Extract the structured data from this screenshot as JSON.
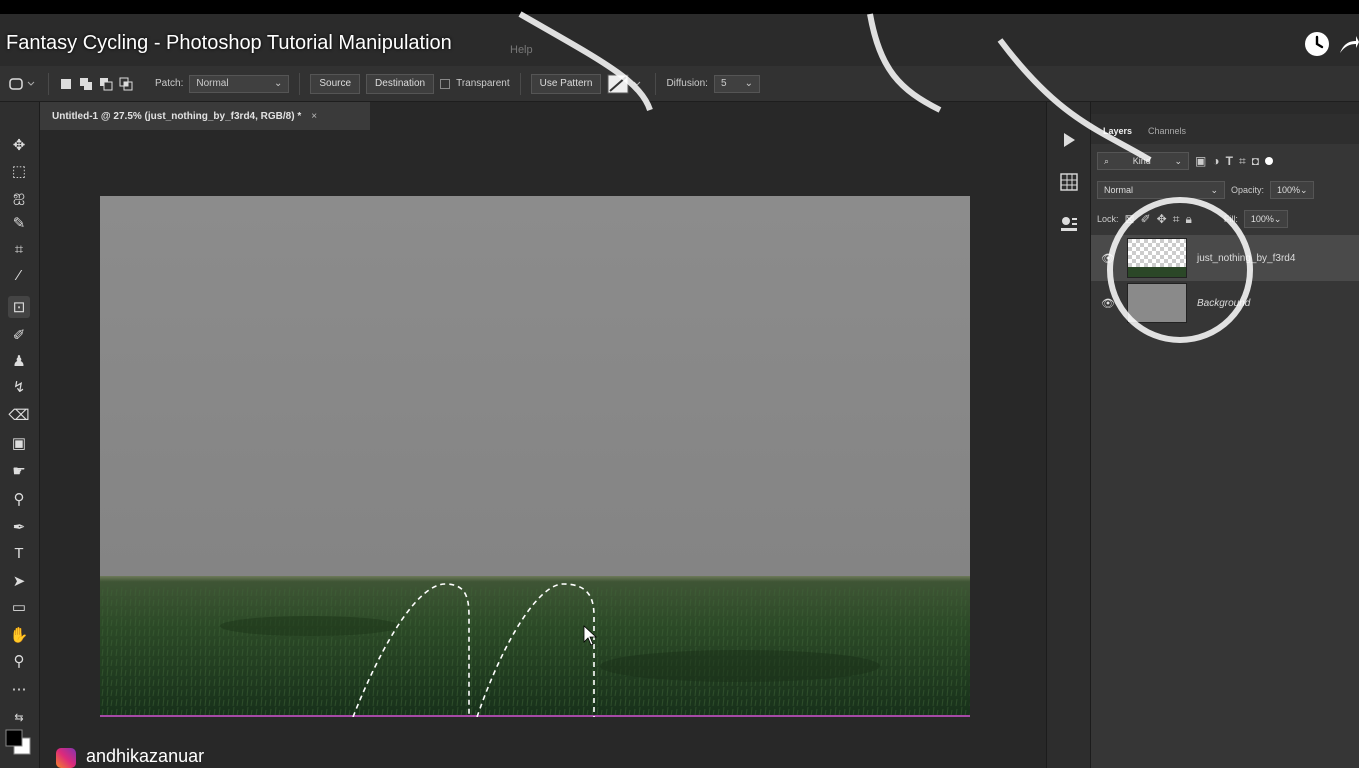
{
  "video": {
    "title": "Fantasy Cycling - Photoshop Tutorial Manipulation",
    "menu_ghost": "Help"
  },
  "options_bar": {
    "patch_label": "Patch:",
    "patch_value": "Normal",
    "source_label": "Source",
    "destination_label": "Destination",
    "transparent_label": "Transparent",
    "use_pattern_label": "Use Pattern",
    "diffusion_label": "Diffusion:",
    "diffusion_value": "5"
  },
  "document": {
    "tab_title": "Untitled-1 @ 27.5% (just_nothing_by_f3rd4, RGB/8) *",
    "close_symbol": "×"
  },
  "layers_panel": {
    "tabs": [
      "Layers",
      "Channels"
    ],
    "kind_label": "Kind",
    "blend_mode": "Normal",
    "opacity_label": "Opacity:",
    "opacity_value": "100%",
    "lock_label": "Lock:",
    "fill_label": "Fill:",
    "fill_value": "100%",
    "layers": [
      {
        "name": "just_nothing_by_f3rd4",
        "selected": true
      },
      {
        "name": "Background",
        "selected": false
      }
    ]
  },
  "credit": {
    "instagram_handle": "andhikazanuar"
  },
  "colors": {
    "canvas_sky": "#8a8a8a",
    "grass_dark": "#1f3a1c",
    "selection_edge": "#a64aa6"
  }
}
